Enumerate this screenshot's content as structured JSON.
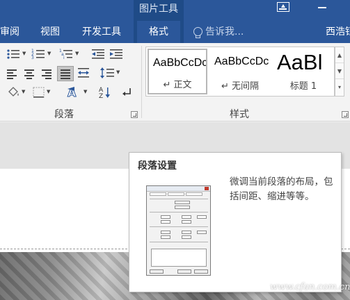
{
  "title_bar": {
    "contextual_group": "图片工具"
  },
  "tabs": [
    {
      "label": "审阅"
    },
    {
      "label": "视图"
    },
    {
      "label": "开发工具"
    },
    {
      "label": "格式"
    }
  ],
  "tell_me": {
    "placeholder": "告诉我..."
  },
  "user": {
    "name": "西浩钰"
  },
  "ribbon": {
    "paragraph_group_label": "段落",
    "styles_group_label": "样式",
    "styles": [
      {
        "sample": "AaBbCcDc",
        "name": "↵ 正文",
        "selected": true
      },
      {
        "sample": "AaBbCcDc",
        "name": "↵ 无间隔",
        "selected": false
      },
      {
        "sample": "AaBl",
        "name": "标题 1",
        "selected": false
      }
    ]
  },
  "tooltip": {
    "title": "段落设置",
    "description": "微调当前段落的布局，包括间距、缩进等等。"
  },
  "watermark": "www.cfan.com.cn",
  "colors": {
    "ribbon_blue": "#2b579a",
    "contextual_band": "#1f4b87",
    "ribbon_body": "#f3f3f3",
    "document_gray": "#e3e3e3"
  },
  "icons": [
    "bullets-icon",
    "numbering-icon",
    "multilevel-list-icon",
    "decrease-indent-icon",
    "increase-indent-icon",
    "align-left-icon",
    "center-icon",
    "align-right-icon",
    "justify-icon",
    "distributed-icon",
    "line-spacing-icon",
    "shading-icon",
    "borders-icon",
    "text-effects-icon",
    "sort-icon",
    "show-marks-icon",
    "restore-icon",
    "minimize-icon",
    "lightbulb-icon",
    "dialog-launcher-icon"
  ]
}
